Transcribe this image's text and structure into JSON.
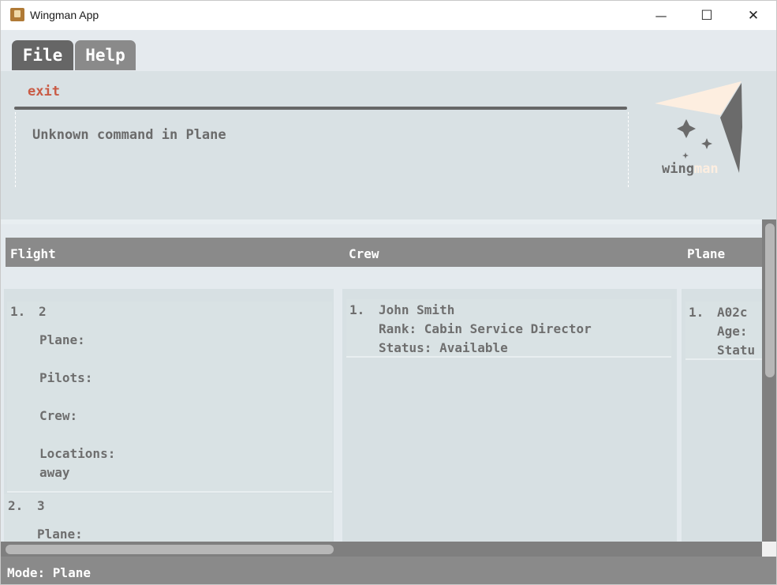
{
  "window": {
    "title": "Wingman App",
    "controls": {
      "minimize": "—",
      "maximize": "☐",
      "close": "✕"
    }
  },
  "menu": [
    {
      "label": "File",
      "active": true
    },
    {
      "label": "Help",
      "active": false
    }
  ],
  "command": {
    "input": "exit",
    "result": "Unknown command in Plane"
  },
  "logo": {
    "text_a": "wing",
    "text_b": "man"
  },
  "columns": [
    "Flight",
    "Crew",
    "Plane"
  ],
  "flights": [
    {
      "index": "1.",
      "code": "2",
      "plane_label": "Plane:",
      "pilots_label": "Pilots:",
      "crew_label": "Crew:",
      "locations_label": "Locations:",
      "locations_value": "away"
    },
    {
      "index": "2.",
      "code": "3",
      "plane_label": "Plane:"
    }
  ],
  "crew": [
    {
      "index": "1.",
      "name": "John Smith",
      "rank": "Rank: Cabin Service Director",
      "status": "Status: Available"
    }
  ],
  "planes": [
    {
      "index": "1.",
      "name": "A02c",
      "age_label": "Age:",
      "status_label": "Statu"
    }
  ],
  "status_bar": {
    "text": "Mode: Plane"
  },
  "colors": {
    "accent_command": "#c95b45",
    "header_bg": "#8a8a8a",
    "tab_active": "#666666",
    "tab_inactive": "#8a8a8a",
    "logo_cream": "#fdeee0",
    "logo_gray": "#6b6b6b"
  }
}
